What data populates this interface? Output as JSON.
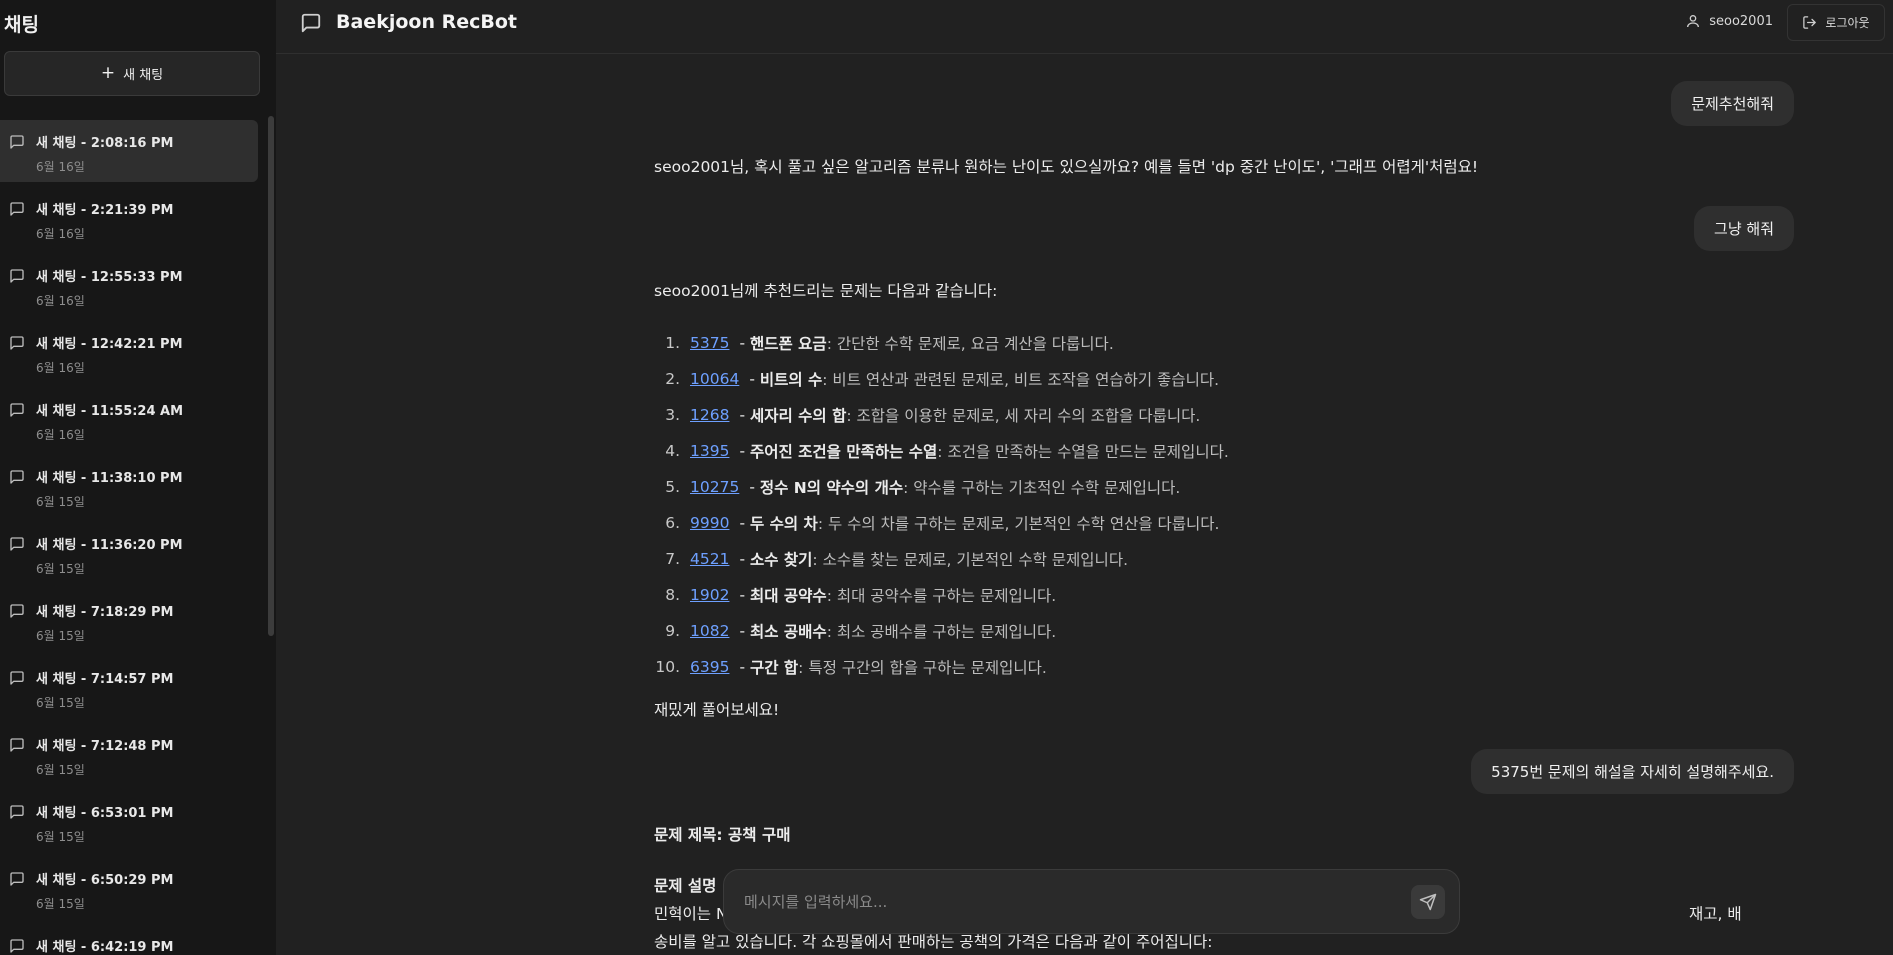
{
  "sidebar": {
    "title": "채팅",
    "new_chat_label": "새 채팅",
    "items": [
      {
        "name": "새 채팅 - 2:08:16 PM",
        "date": "6월 16일",
        "active": true
      },
      {
        "name": "새 채팅 - 2:21:39 PM",
        "date": "6월 16일"
      },
      {
        "name": "새 채팅 - 12:55:33 PM",
        "date": "6월 16일"
      },
      {
        "name": "새 채팅 - 12:42:21 PM",
        "date": "6월 16일"
      },
      {
        "name": "새 채팅 - 11:55:24 AM",
        "date": "6월 16일"
      },
      {
        "name": "새 채팅 - 11:38:10 PM",
        "date": "6월 15일"
      },
      {
        "name": "새 채팅 - 11:36:20 PM",
        "date": "6월 15일"
      },
      {
        "name": "새 채팅 - 7:18:29 PM",
        "date": "6월 15일"
      },
      {
        "name": "새 채팅 - 7:14:57 PM",
        "date": "6월 15일"
      },
      {
        "name": "새 채팅 - 7:12:48 PM",
        "date": "6월 15일"
      },
      {
        "name": "새 채팅 - 6:53:01 PM",
        "date": "6월 15일"
      },
      {
        "name": "새 채팅 - 6:50:29 PM",
        "date": "6월 15일"
      },
      {
        "name": "새 채팅 - 6:42:19 PM",
        "date": "6월 15일"
      }
    ]
  },
  "header": {
    "title": "Baekjoon RecBot",
    "username": "seoo2001",
    "logout_label": "로그아웃"
  },
  "messages": {
    "user1": "문제추천해줘",
    "bot1": "seoo2001님, 혹시 풀고 싶은 알고리즘 분류나 원하는 난이도 있으실까요? 예를 들면 'dp 중간 난이도', '그래프 어렵게'처럼요!",
    "user2": "그냥 해줘",
    "bot2_intro": "seoo2001님께 추천드리는 문제는 다음과 같습니다:",
    "recommendations": [
      {
        "num": "1.",
        "id": "5375",
        "title": "핸드폰 요금",
        "desc": ": 간단한 수학 문제로, 요금 계산을 다룹니다."
      },
      {
        "num": "2.",
        "id": "10064",
        "title": "비트의 수",
        "desc": ": 비트 연산과 관련된 문제로, 비트 조작을 연습하기 좋습니다."
      },
      {
        "num": "3.",
        "id": "1268",
        "title": "세자리 수의 합",
        "desc": ": 조합을 이용한 문제로, 세 자리 수의 조합을 다룹니다."
      },
      {
        "num": "4.",
        "id": "1395",
        "title": "주어진 조건을 만족하는 수열",
        "desc": ": 조건을 만족하는 수열을 만드는 문제입니다."
      },
      {
        "num": "5.",
        "id": "10275",
        "title": "정수 N의 약수의 개수",
        "desc": ": 약수를 구하는 기초적인 수학 문제입니다."
      },
      {
        "num": "6.",
        "id": "9990",
        "title": "두 수의 차",
        "desc": ": 두 수의 차를 구하는 문제로, 기본적인 수학 연산을 다룹니다."
      },
      {
        "num": "7.",
        "id": "4521",
        "title": "소수 찾기",
        "desc": ": 소수를 찾는 문제로, 기본적인 수학 문제입니다."
      },
      {
        "num": "8.",
        "id": "1902",
        "title": "최대 공약수",
        "desc": ": 최대 공약수를 구하는 문제입니다."
      },
      {
        "num": "9.",
        "id": "1082",
        "title": "최소 공배수",
        "desc": ": 최소 공배수를 구하는 문제입니다."
      },
      {
        "num": "10.",
        "id": "6395",
        "title": "구간 합",
        "desc": ": 특정 구간의 합을 구하는 문제입니다."
      }
    ],
    "bot2_outro": "재밌게 풀어보세요!",
    "user3": "5375번 문제의 해설을 자세히 설명해주세요.",
    "bot3_title": "문제 제목: 공책 구매",
    "bot3_section": "문제 설명",
    "bot3_line1_start": "민혁이는 N",
    "bot3_line1_end": "재고, 배",
    "bot3_line2": "송비를 알고 있습니다. 각 쇼핑몰에서 판매하는 공책의 가격은 다음과 같이 주어집니다:"
  },
  "input": {
    "placeholder": "메시지를 입력하세요..."
  },
  "icons": {
    "app": "message-square-icon",
    "user": "user-icon",
    "logout": "logout-icon",
    "send": "send-icon",
    "plus": "plus-icon"
  }
}
